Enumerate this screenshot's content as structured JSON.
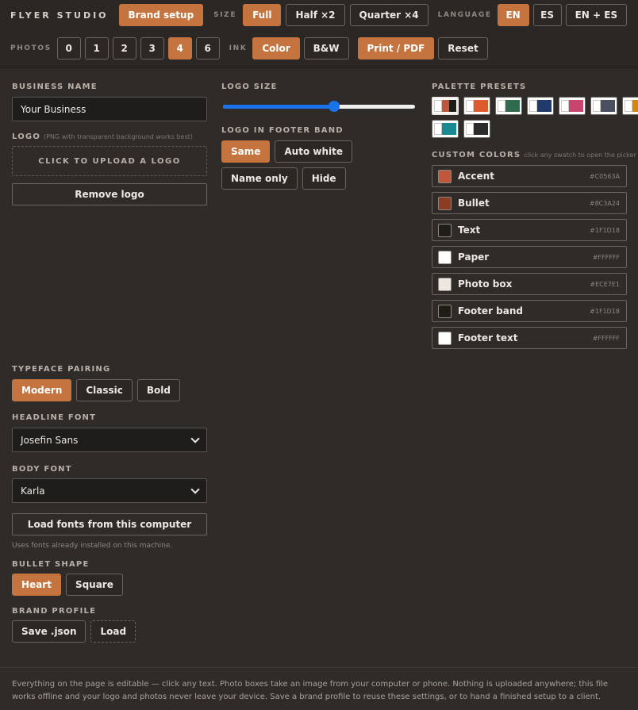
{
  "app": {
    "title": "FLYER STUDIO",
    "brand_setup": "Brand setup"
  },
  "size": {
    "label": "SIZE",
    "options": [
      "Full",
      "Half ×2",
      "Quarter ×4"
    ],
    "active": "Full"
  },
  "language": {
    "label": "LANGUAGE",
    "options": [
      "EN",
      "ES",
      "EN + ES"
    ],
    "active": "EN"
  },
  "photos": {
    "label": "PHOTOS",
    "options": [
      "0",
      "1",
      "2",
      "3",
      "4",
      "6"
    ],
    "active": "4"
  },
  "ink": {
    "label": "INK",
    "options": [
      "Color",
      "B&W"
    ],
    "active": "Color"
  },
  "actions": {
    "print": "Print / PDF",
    "reset": "Reset"
  },
  "business": {
    "label": "BUSINESS NAME",
    "value": "Your Business"
  },
  "logo": {
    "label": "LOGO",
    "hint": "(PNG with transparent background works best)",
    "upload": "CLICK TO UPLOAD A LOGO",
    "remove": "Remove logo"
  },
  "logo_size": {
    "label": "LOGO SIZE",
    "value": 0.58
  },
  "footer_band": {
    "label": "LOGO IN FOOTER BAND",
    "options": [
      "Same",
      "Auto white",
      "Name only",
      "Hide"
    ],
    "active": "Same"
  },
  "palette": {
    "label": "PALETTE PRESETS",
    "presets": [
      [
        "#ffffff",
        "#c0563a",
        "#1f1d18"
      ],
      [
        "#ffffff",
        "#e05a30",
        "#e05a30"
      ],
      [
        "#ffffff",
        "#2e6b4f",
        "#2e6b4f"
      ],
      [
        "#ffffff",
        "#1f3a6b",
        "#1f3a6b"
      ],
      [
        "#ffffff",
        "#c8466e",
        "#c8466e"
      ],
      [
        "#ffffff",
        "#4a5060",
        "#4a5060"
      ],
      [
        "#ffffff",
        "#d4880a",
        "#d4880a"
      ],
      [
        "#ffffff",
        "#1a8a92",
        "#1a8a92"
      ],
      [
        "#ffffff",
        "#2b2b2b",
        "#2b2b2b"
      ]
    ]
  },
  "custom_colors": {
    "label": "CUSTOM COLORS",
    "hint": "click any swatch to open the picker",
    "items": [
      {
        "name": "Accent",
        "hex": "#C0563A"
      },
      {
        "name": "Bullet",
        "hex": "#8C3A24"
      },
      {
        "name": "Text",
        "hex": "#1F1D18"
      },
      {
        "name": "Paper",
        "hex": "#FFFFFF"
      },
      {
        "name": "Photo box",
        "hex": "#ECE7E1"
      },
      {
        "name": "Footer band",
        "hex": "#1F1D18"
      },
      {
        "name": "Footer text",
        "hex": "#FFFFFF"
      }
    ]
  },
  "typeface": {
    "label": "TYPEFACE PAIRING",
    "options": [
      "Modern",
      "Classic",
      "Bold"
    ],
    "active": "Modern"
  },
  "headline_font": {
    "label": "HEADLINE FONT",
    "value": "Josefin Sans"
  },
  "body_font": {
    "label": "BODY FONT",
    "value": "Karla"
  },
  "load_fonts": {
    "button": "Load fonts from this computer",
    "hint": "Uses fonts already installed on this machine."
  },
  "bullet": {
    "label": "BULLET SHAPE",
    "options": [
      "Heart",
      "Square"
    ],
    "active": "Heart"
  },
  "brand_profile": {
    "label": "BRAND PROFILE",
    "save": "Save .json",
    "load": "Load"
  },
  "footer_note": "Everything on the page is editable — click any text. Photo boxes take an image from your computer or phone. Nothing is uploaded anywhere; this file works offline and your logo and photos never leave your device. Save a brand profile to reuse these settings, or to hand a finished setup to a client."
}
